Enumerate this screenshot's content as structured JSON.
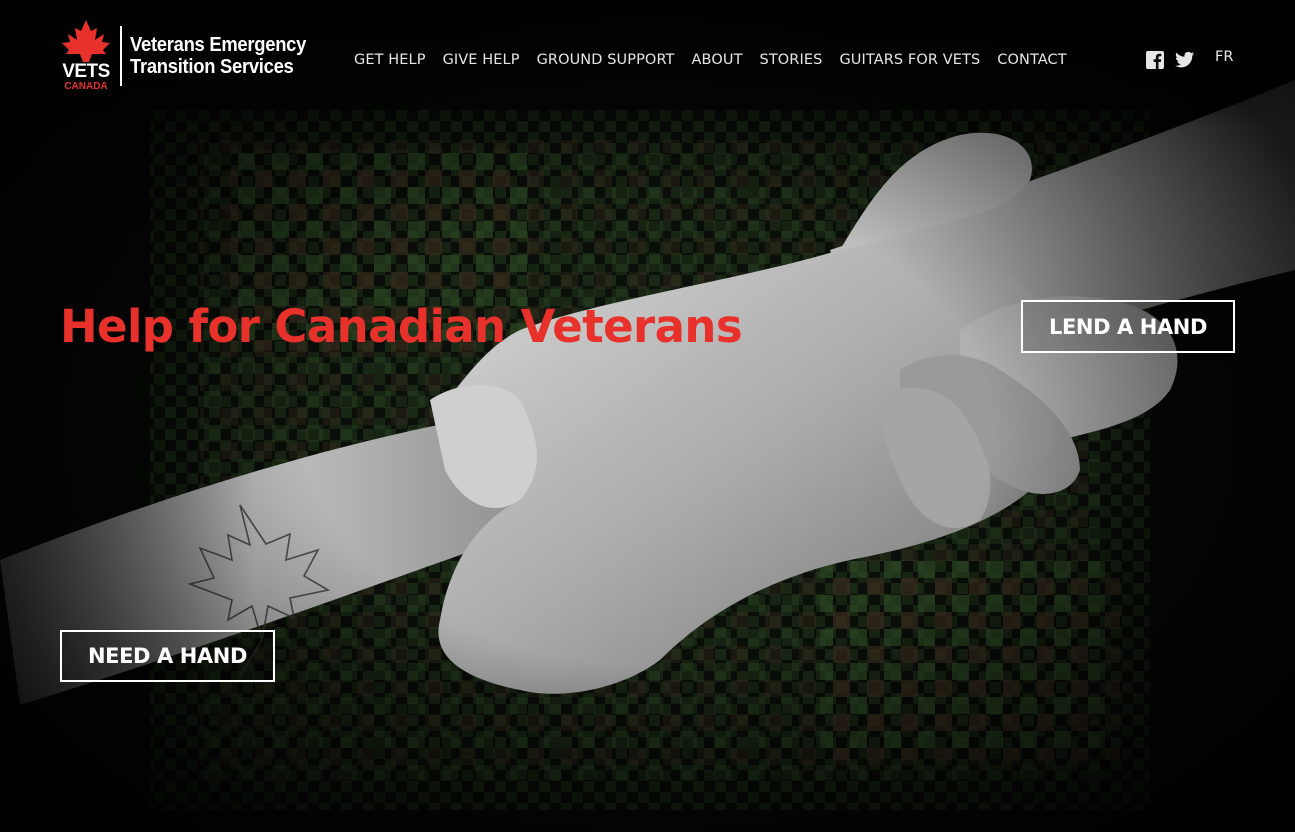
{
  "brand": {
    "logo_word": "VETS",
    "logo_sub": "CANADA",
    "name_line1": "Veterans Emergency",
    "name_line2": "Transition Services",
    "accent_color": "#e8312a"
  },
  "nav": {
    "items": [
      "GET HELP",
      "GIVE HELP",
      "GROUND SUPPORT",
      "ABOUT",
      "STORIES",
      "GUITARS FOR VETS",
      "CONTACT"
    ],
    "social_icons": [
      "facebook-icon",
      "twitter-icon"
    ],
    "language_toggle": "FR"
  },
  "hero": {
    "headline": "Help for Canadian Veterans",
    "lend_button": "LEND A HAND",
    "need_button": "NEED A HAND",
    "image_subject": "clasped-hands-over-camouflage"
  }
}
